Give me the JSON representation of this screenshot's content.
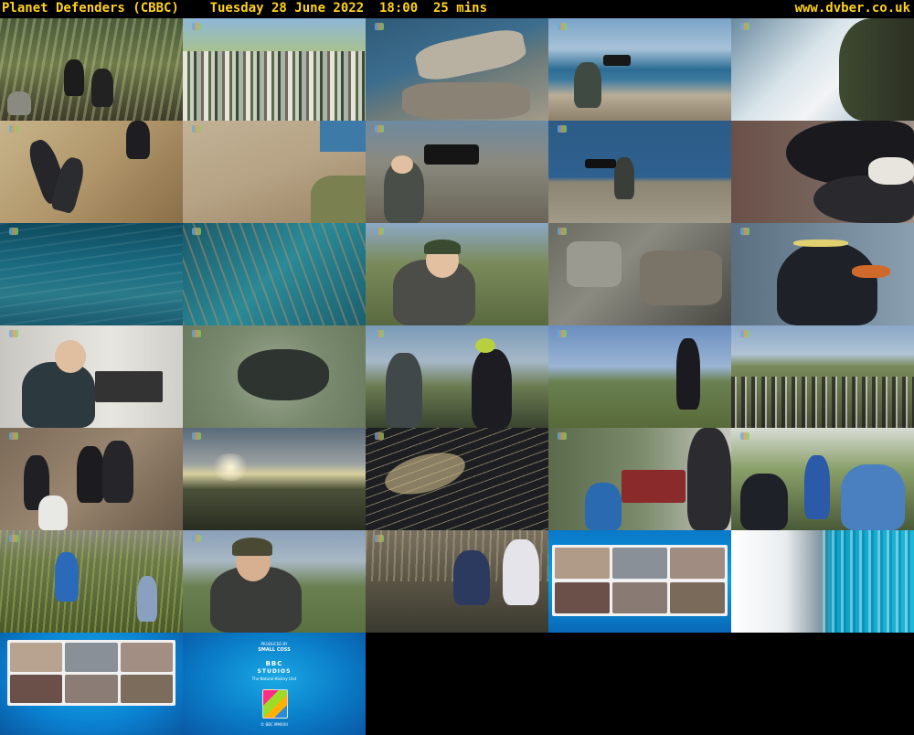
{
  "header": {
    "title": "Planet Defenders (CBBC)    Tuesday 28 June 2022  18:00  25 mins",
    "site": "www.dvber.co.uk"
  },
  "end_card": {
    "produced_by": "PRODUCED BY",
    "team": "SMALL COSS",
    "studio_mark": "BBC",
    "studio_word": "STUDIOS",
    "unit": "The Natural History Unit",
    "copyright": "© BBC MMXXII"
  },
  "thumbnails": [
    {
      "id": 1,
      "scene": "penguins among tussock grass"
    },
    {
      "id": 2,
      "scene": "colour bar transition"
    },
    {
      "id": 3,
      "scene": "rocky coastline"
    },
    {
      "id": 4,
      "scene": "camera operator on clifftop"
    },
    {
      "id": 5,
      "scene": "waves against cliff"
    },
    {
      "id": 6,
      "scene": "penguins climbing rocks"
    },
    {
      "id": 7,
      "scene": "sloping rock ledge"
    },
    {
      "id": 8,
      "scene": "presenter with camera"
    },
    {
      "id": 9,
      "scene": "camera on coastal rocks"
    },
    {
      "id": 10,
      "scene": "penguin close-up"
    },
    {
      "id": 11,
      "scene": "ocean surface"
    },
    {
      "id": 12,
      "scene": "plastic in water"
    },
    {
      "id": 13,
      "scene": "smiling presenter"
    },
    {
      "id": 14,
      "scene": "debris among rocks"
    },
    {
      "id": 15,
      "scene": "rockhopper penguin portrait"
    },
    {
      "id": 16,
      "scene": "presenter in hut"
    },
    {
      "id": 17,
      "scene": "aerial penguin colony"
    },
    {
      "id": 18,
      "scene": "two presenters talking"
    },
    {
      "id": 19,
      "scene": "walking across colony"
    },
    {
      "id": 20,
      "scene": "penguin colony wide"
    },
    {
      "id": 21,
      "scene": "rockhopper penguins"
    },
    {
      "id": 22,
      "scene": "sunset over hills"
    },
    {
      "id": 23,
      "scene": "seeds on black cloth"
    },
    {
      "id": 24,
      "scene": "children with seed trays"
    },
    {
      "id": 25,
      "scene": "children in polytunnel"
    },
    {
      "id": 26,
      "scene": "children in tall grass"
    },
    {
      "id": 27,
      "scene": "presenter in hat"
    },
    {
      "id": 28,
      "scene": "penguin at stream"
    },
    {
      "id": 29,
      "scene": "video call grid"
    },
    {
      "id": 30,
      "scene": "colour bar transition"
    },
    {
      "id": 31,
      "scene": "video call grid"
    },
    {
      "id": 32,
      "scene": "end credits"
    }
  ]
}
